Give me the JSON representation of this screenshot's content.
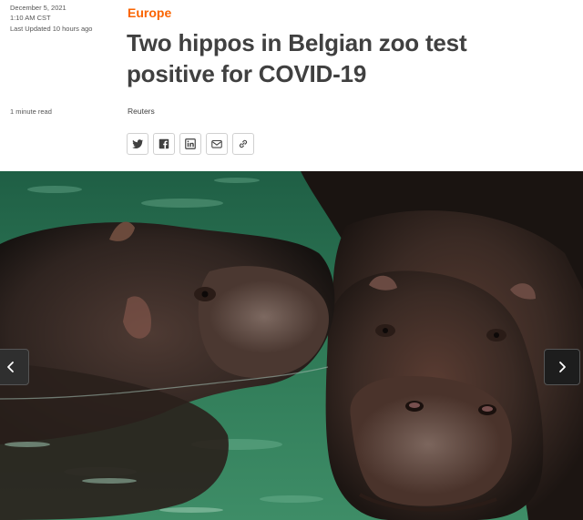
{
  "meta": {
    "date": "December 5, 2021",
    "time": "1:10 AM CST",
    "updated": "Last Updated 10 hours ago",
    "read_time": "1 minute read"
  },
  "article": {
    "section": "Europe",
    "headline": "Two hippos in Belgian zoo test positive for COVID-19",
    "byline": "Reuters"
  },
  "share": {
    "icons": [
      "twitter-icon",
      "facebook-icon",
      "linkedin-icon",
      "email-icon",
      "link-icon"
    ]
  },
  "hero": {
    "carousel": {
      "prev_icon": "chevron-left-icon",
      "next_icon": "chevron-right-icon"
    }
  },
  "colors": {
    "accent": "#fa6400",
    "headline": "#404040",
    "water": "#2f7a57",
    "hippo": "#3a2a24"
  }
}
